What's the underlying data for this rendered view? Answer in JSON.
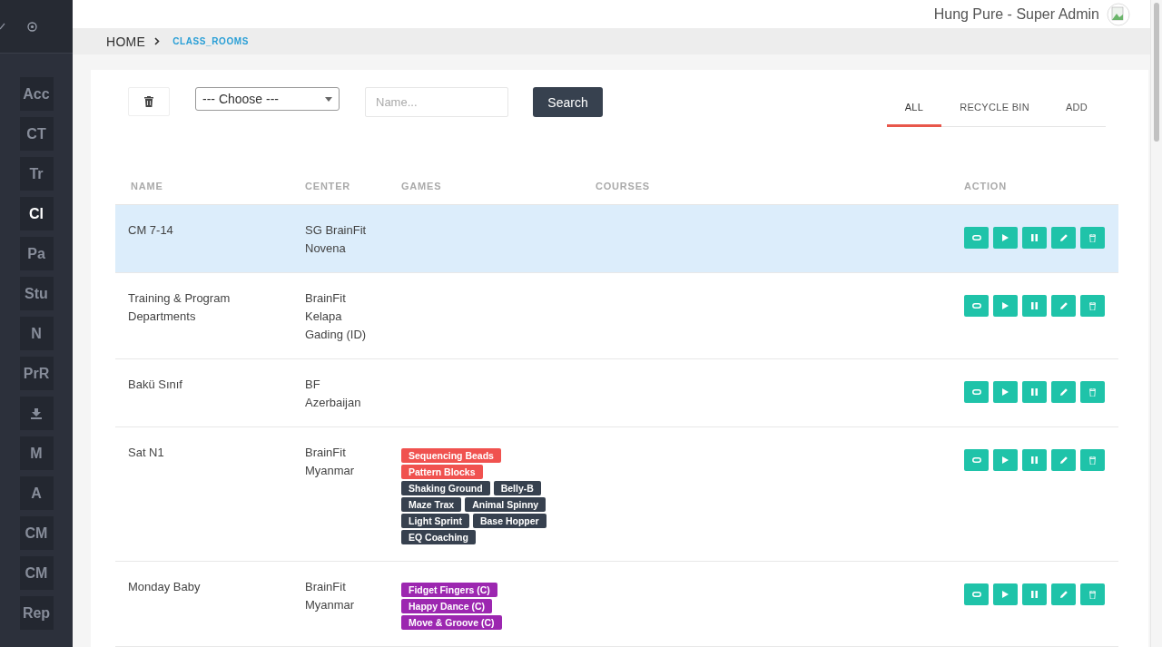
{
  "sidebar": {
    "items": [
      {
        "label": "Acc",
        "kind": "text",
        "selected": false
      },
      {
        "label": "CT",
        "kind": "text",
        "selected": false
      },
      {
        "label": "Tr",
        "kind": "text",
        "selected": false
      },
      {
        "label": "Cl",
        "kind": "text",
        "selected": true
      },
      {
        "label": "Pa",
        "kind": "text",
        "selected": false
      },
      {
        "label": "Stu",
        "kind": "text",
        "selected": false
      },
      {
        "label": "N",
        "kind": "text",
        "selected": false
      },
      {
        "label": "PrR",
        "kind": "text",
        "selected": false
      },
      {
        "kind": "download",
        "selected": false
      },
      {
        "label": "M",
        "kind": "text",
        "selected": false
      },
      {
        "label": "A",
        "kind": "text",
        "selected": false
      },
      {
        "label": "CM",
        "kind": "text",
        "selected": false
      },
      {
        "label": "CM",
        "kind": "text",
        "selected": false
      },
      {
        "label": "Rep",
        "kind": "text",
        "selected": false
      }
    ]
  },
  "header": {
    "user": "Hung Pure - Super Admin"
  },
  "breadcrumb": [
    "HOME",
    "CLASS_ROOMS"
  ],
  "filters": {
    "select": "--- Choose ---",
    "placeholder": "Name...",
    "search": "Search"
  },
  "tabs": [
    {
      "label": "ALL",
      "selected": true
    },
    {
      "label": "RECYCLE BIN",
      "selected": false
    },
    {
      "label": "ADD",
      "selected": false
    }
  ],
  "table": {
    "columns": [
      "NAME",
      "CENTER",
      "GAMES",
      "COURSES",
      "ACTION"
    ],
    "rows": [
      {
        "name": "CM 7-14",
        "center": [
          "SG BrainFit",
          "Novena"
        ],
        "selected": true,
        "games": []
      },
      {
        "name": "Training & Program Departments",
        "center": [
          "BrainFit",
          "Kelapa",
          "Gading (ID)"
        ],
        "selected": false,
        "games": []
      },
      {
        "name": "Bakü Sınıf",
        "center": [
          "BF",
          "Azerbaijan"
        ],
        "selected": false,
        "games": []
      },
      {
        "name": "Sat N1",
        "center": [
          "BrainFit",
          "Myanmar"
        ],
        "selected": false,
        "games": [
          {
            "label": "Sequencing Beads",
            "color": "#f0524f"
          },
          {
            "label": "Pattern Blocks",
            "color": "#f0524f"
          },
          {
            "label": "Shaking Ground",
            "color": "#37414f"
          },
          {
            "label": "Belly-B",
            "color": "#37414f"
          },
          {
            "label": "Maze Trax",
            "color": "#37414f"
          },
          {
            "label": "Animal Spinny",
            "color": "#37414f"
          },
          {
            "label": "Light Sprint",
            "color": "#37414f"
          },
          {
            "label": "Base Hopper",
            "color": "#37414f"
          },
          {
            "label": "EQ Coaching",
            "color": "#37414f"
          }
        ]
      },
      {
        "name": "Monday Baby",
        "center": [
          "BrainFit",
          "Myanmar"
        ],
        "selected": false,
        "games": [
          {
            "label": "Fidget Fingers (C)",
            "color": "#9c27b0"
          },
          {
            "label": "Happy Dance (C)",
            "color": "#9c27b0"
          },
          {
            "label": "Move & Groove (C)",
            "color": "#9c27b0"
          }
        ]
      }
    ]
  }
}
